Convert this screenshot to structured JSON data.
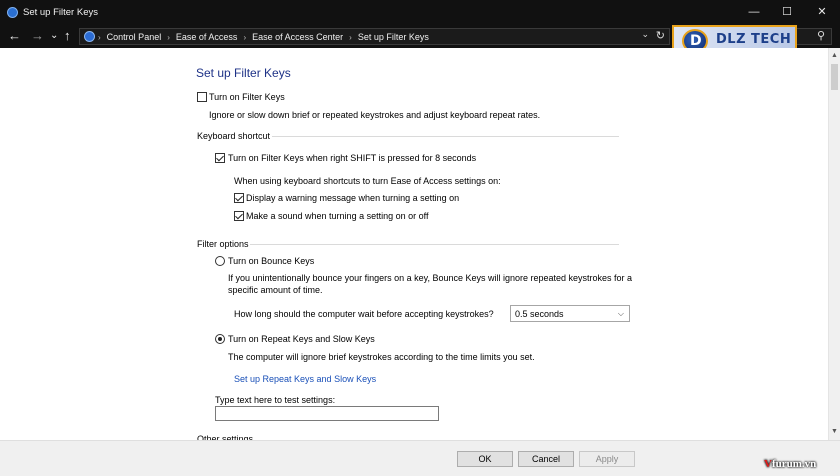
{
  "window": {
    "title": "Set up Filter Keys",
    "minimize_glyph": "—",
    "maximize_glyph": "☐",
    "close_glyph": "✕"
  },
  "nav": {
    "back_glyph": "←",
    "forward_glyph": "→",
    "history_glyph": "⌄",
    "up_glyph": "↑",
    "breadcrumbs": [
      "Control Panel",
      "Ease of Access",
      "Ease of Access Center",
      "Set up Filter Keys"
    ],
    "dropdown_glyph": "⌄",
    "refresh_glyph": "↻",
    "search_glyph": "⚲"
  },
  "logo": {
    "text": "DLZ TECH"
  },
  "page": {
    "title": "Set up Filter Keys",
    "filter_keys": {
      "label": "Turn on Filter Keys",
      "checked": false,
      "description": "Ignore or slow down brief or repeated keystrokes and adjust keyboard repeat rates."
    },
    "keyboard_shortcut": {
      "heading": "Keyboard shortcut",
      "shift_option": {
        "label": "Turn on Filter Keys when right SHIFT is pressed for 8 seconds",
        "checked": true
      },
      "intro": "When using keyboard shortcuts to turn Ease of Access settings on:",
      "warning_option": {
        "label": "Display a warning message when turning a setting on",
        "checked": true
      },
      "sound_option": {
        "label": "Make a sound when turning a setting on or off",
        "checked": true
      }
    },
    "filter_options": {
      "heading": "Filter options",
      "bounce": {
        "label": "Turn on Bounce Keys",
        "selected": false,
        "description_line1": "If you unintentionally bounce your fingers on a key, Bounce Keys will ignore repeated keystrokes for a",
        "description_line2": "specific amount of time.",
        "wait_label": "How long should the computer wait before accepting keystrokes?",
        "wait_value": "0.5 seconds"
      },
      "repeat": {
        "label": "Turn on Repeat Keys and Slow Keys",
        "selected": true,
        "description": "The computer will ignore brief keystrokes according to the time limits you set.",
        "link": "Set up Repeat Keys and Slow Keys"
      },
      "test_label": "Type text here to test settings:",
      "test_value": ""
    },
    "other_settings_partial": "Other settings"
  },
  "footer": {
    "ok": "OK",
    "cancel": "Cancel",
    "apply": "Apply"
  },
  "watermark": {
    "v": "V",
    "rest": "furum.vn"
  }
}
